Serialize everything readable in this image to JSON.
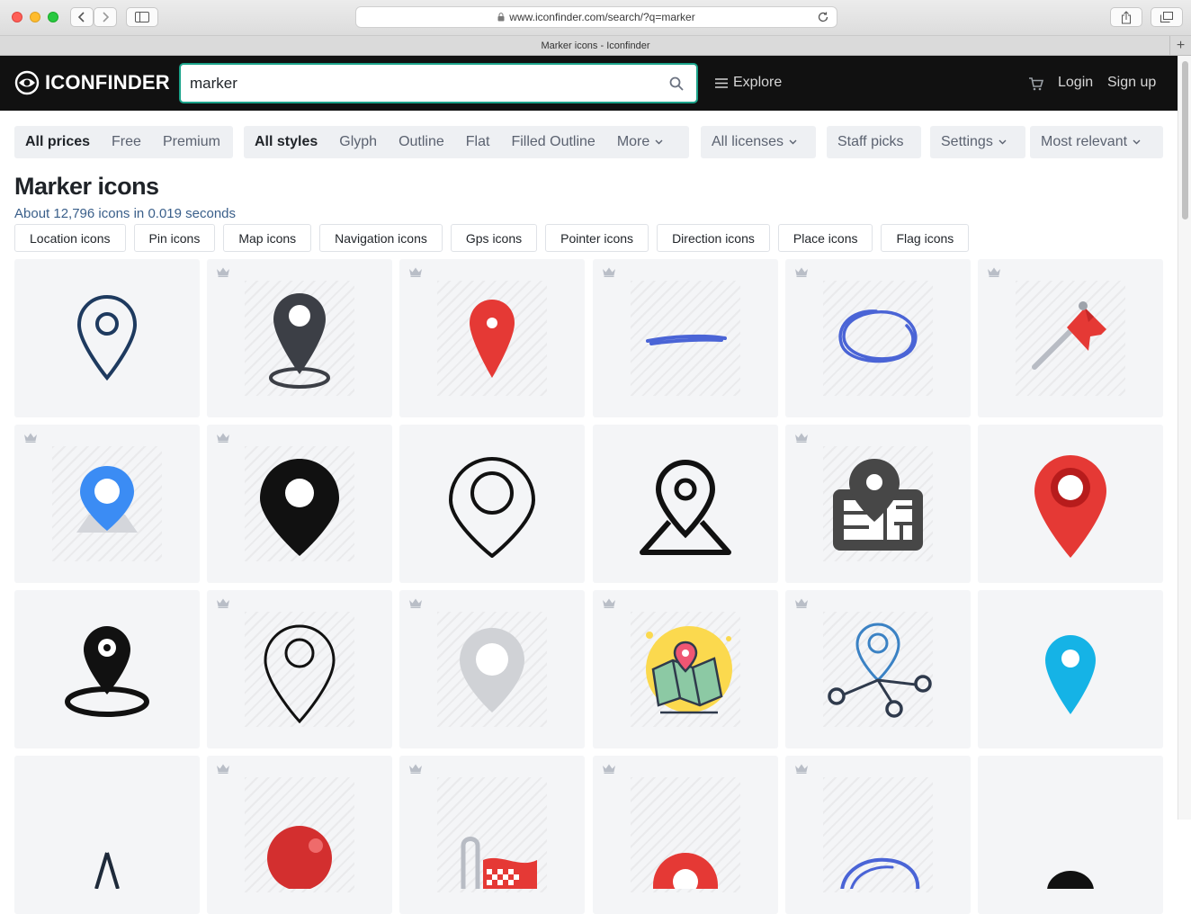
{
  "browser": {
    "url": "www.iconfinder.com/search/?q=marker",
    "tab_title": "Marker icons - Iconfinder"
  },
  "header": {
    "logo": "ICONFINDER",
    "search_value": "marker",
    "explore": "Explore",
    "login": "Login",
    "signup": "Sign up"
  },
  "filters": {
    "prices": [
      "All prices",
      "Free",
      "Premium"
    ],
    "styles": [
      "All styles",
      "Glyph",
      "Outline",
      "Flat",
      "Filled Outline",
      "More"
    ],
    "licenses": "All licenses",
    "staff_picks": "Staff picks",
    "settings": "Settings",
    "sort": "Most relevant"
  },
  "results": {
    "title": "Marker icons",
    "summary": "About 12,796 icons in 0.019 seconds"
  },
  "related": [
    "Location icons",
    "Pin icons",
    "Map icons",
    "Navigation icons",
    "Gps icons",
    "Pointer icons",
    "Direction icons",
    "Place icons",
    "Flag icons"
  ],
  "icons": [
    {
      "icon": "outline-pin-icon",
      "premium": false
    },
    {
      "icon": "pin-with-ring-icon",
      "premium": true
    },
    {
      "icon": "red-pin-icon",
      "premium": true
    },
    {
      "icon": "blue-underline-stroke-icon",
      "premium": true
    },
    {
      "icon": "blue-circle-scribble-icon",
      "premium": true
    },
    {
      "icon": "red-flag-pushpin-icon",
      "premium": true
    },
    {
      "icon": "blue-pin-on-map-icon",
      "premium": true
    },
    {
      "icon": "black-pin-icon",
      "premium": true
    },
    {
      "icon": "outline-pin-big-ring-icon",
      "premium": false
    },
    {
      "icon": "pin-on-triangle-icon",
      "premium": false
    },
    {
      "icon": "pin-on-city-map-icon",
      "premium": true
    },
    {
      "icon": "red-pin-dark-ring-icon",
      "premium": false
    },
    {
      "icon": "black-pin-with-ellipse-icon",
      "premium": false
    },
    {
      "icon": "outline-tall-pin-icon",
      "premium": true
    },
    {
      "icon": "gray-pin-icon",
      "premium": true
    },
    {
      "icon": "map-with-pin-illustration-icon",
      "premium": true
    },
    {
      "icon": "pin-network-icon",
      "premium": true
    },
    {
      "icon": "cyan-pin-icon",
      "premium": false
    },
    {
      "icon": "compass-point-icon",
      "premium": false
    },
    {
      "icon": "red-ball-pushpin-icon",
      "premium": true
    },
    {
      "icon": "checkered-flag-clip-icon",
      "premium": true
    },
    {
      "icon": "red-pin-partial-icon",
      "premium": true
    },
    {
      "icon": "blue-scribble-partial-icon",
      "premium": true
    },
    {
      "icon": "black-pin-partial-icon",
      "premium": false
    }
  ]
}
